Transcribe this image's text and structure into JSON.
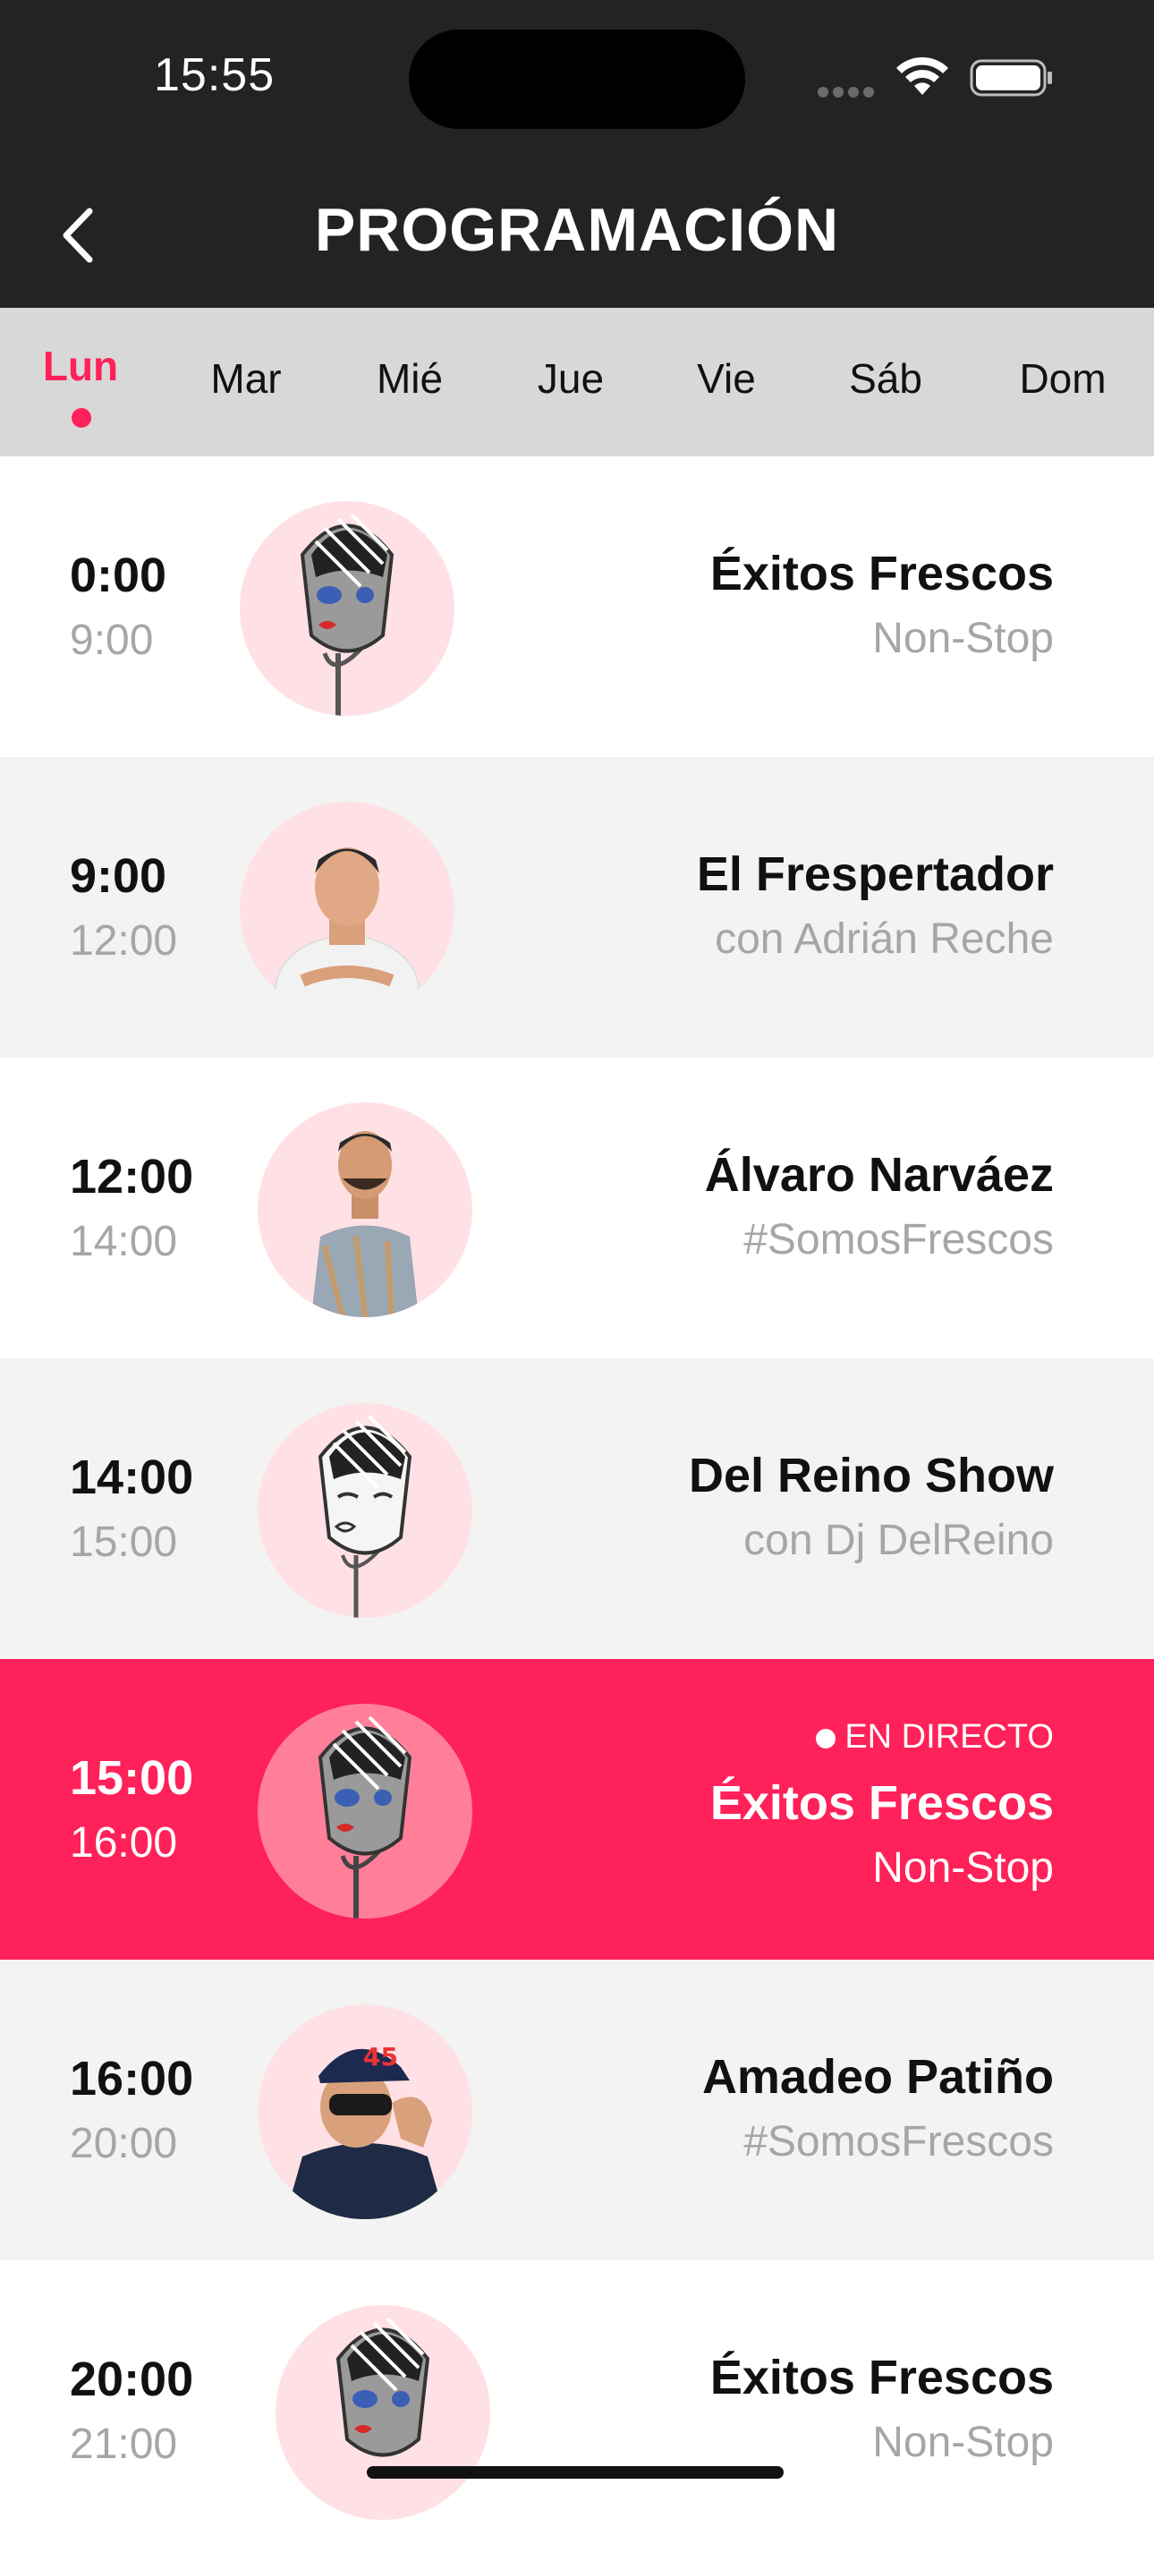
{
  "status_bar": {
    "time": "15:55"
  },
  "header": {
    "title": "PROGRAMACIÓN",
    "back_icon": "chevron-left-icon"
  },
  "days": [
    {
      "label": "Lun",
      "active": true
    },
    {
      "label": "Mar",
      "active": false
    },
    {
      "label": "Mié",
      "active": false
    },
    {
      "label": "Jue",
      "active": false
    },
    {
      "label": "Vie",
      "active": false
    },
    {
      "label": "Sáb",
      "active": false
    },
    {
      "label": "Dom",
      "active": false
    }
  ],
  "schedule": [
    {
      "start": "0:00",
      "end": "9:00",
      "title": "Éxitos Frescos",
      "subtitle": "Non-Stop",
      "avatar": "microphone-mascot-icon",
      "live": false
    },
    {
      "start": "9:00",
      "end": "12:00",
      "title": "El Frespertador",
      "subtitle": "con Adrián Reche",
      "avatar": "host-photo-icon",
      "live": false
    },
    {
      "start": "12:00",
      "end": "14:00",
      "title": "Álvaro Narváez",
      "subtitle": "#SomosFrescos",
      "avatar": "host-photo-icon",
      "live": false
    },
    {
      "start": "14:00",
      "end": "15:00",
      "title": "Del Reino Show",
      "subtitle": "con Dj DelReino",
      "avatar": "microphone-mascot-sketch-icon",
      "live": false
    },
    {
      "start": "15:00",
      "end": "16:00",
      "title": "Éxitos Frescos",
      "subtitle": "Non-Stop",
      "avatar": "microphone-mascot-icon",
      "live": true,
      "live_label": "EN DIRECTO"
    },
    {
      "start": "16:00",
      "end": "20:00",
      "title": "Amadeo Patiño",
      "subtitle": "#SomosFrescos",
      "avatar": "host-photo-icon",
      "live": false
    },
    {
      "start": "20:00",
      "end": "21:00",
      "title": "Éxitos Frescos",
      "subtitle": "Non-Stop",
      "avatar": "microphone-mascot-icon",
      "live": false
    }
  ],
  "colors": {
    "accent": "#ff2159",
    "header_bg": "#232323",
    "daybar_bg": "#d8d8d8",
    "row_alt_bg": "#f3f3f3",
    "avatar_bg": "#ffe1e5"
  }
}
